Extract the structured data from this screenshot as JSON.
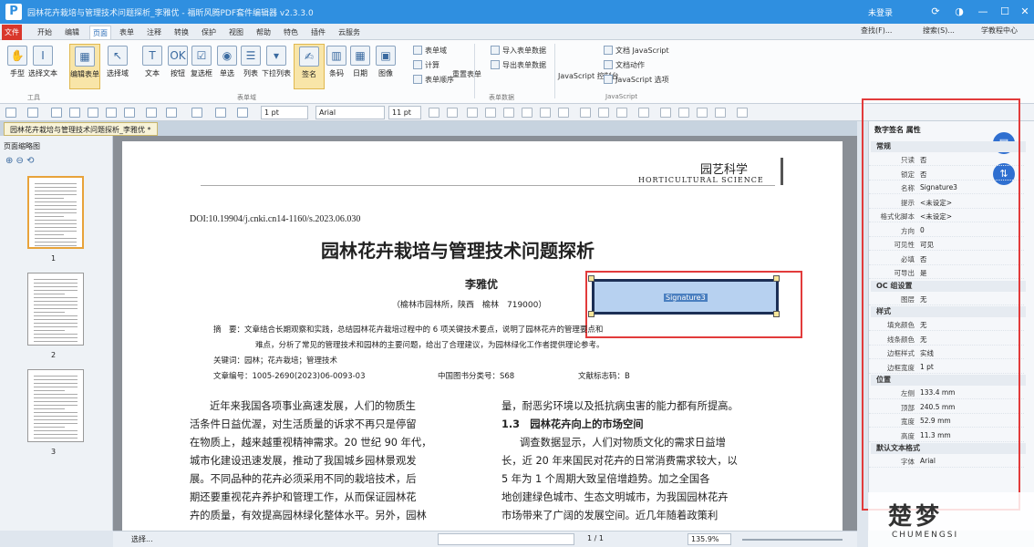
{
  "titlebar": {
    "app_logo": "P",
    "title": "园林花卉栽培与管理技术问题探析_李雅优 - 福昕风腾PDF套件编辑器 v2.3.3.0",
    "user": "未登录"
  },
  "menu": {
    "file": "文件",
    "tabs": [
      "开始",
      "编辑",
      "页面",
      "表单",
      "注释",
      "转换",
      "保护",
      "视图",
      "帮助",
      "特色",
      "插件",
      "云服务"
    ],
    "active_index": 2,
    "right": [
      "查找(F)...",
      "搜索(S)...",
      "学教程中心"
    ]
  },
  "ribbon": {
    "big_buttons": [
      {
        "label": "手型"
      },
      {
        "label": "选择文本"
      },
      {
        "label": "编辑表单"
      },
      {
        "label": "选择域"
      },
      {
        "label": "文本"
      },
      {
        "label": "按钮"
      },
      {
        "label": "复选框"
      },
      {
        "label": "单选"
      },
      {
        "label": "列表"
      },
      {
        "label": "下拉列表"
      },
      {
        "label": "签名"
      },
      {
        "label": "条码"
      },
      {
        "label": "日期"
      },
      {
        "label": "图像"
      }
    ],
    "small_left": [
      "表单域",
      "计算",
      "表单顺序"
    ],
    "data_group": [
      "导入表单数据",
      "导出表单数据",
      "重置表单"
    ],
    "js_group": [
      "文档 JavaScript",
      "文档动作",
      "JavaScript 控制台",
      "JavaScript 选项"
    ],
    "group_labels": [
      "工具",
      "表单域",
      "表单数据",
      "JavaScript"
    ]
  },
  "toolbar": {
    "line_width": "1 pt",
    "font": "Arial",
    "font_size": "11 pt"
  },
  "doc_tab": "园林花卉栽培与管理技术问题探析_李雅优 *",
  "left_panel": {
    "title": "页面缩略图",
    "pages": [
      "1",
      "2",
      "3"
    ]
  },
  "page": {
    "journal_cn": "园艺科学",
    "journal_en": "HORTICULTURAL SCIENCE",
    "doi": "DOI:10.19904/j.cnki.cn14-1160/s.2023.06.030",
    "title": "园林花卉栽培与管理技术问题探析",
    "author": "李雅优",
    "affiliation": "（榆林市园林所，陕西　榆林　719000）",
    "signature_field": "Signature3",
    "abstract1": "摘　要：文章结合长期观察和实践，总结园林花卉栽培过程中的 6 项关键技术要点，说明了园林花卉的管理要点和",
    "abstract2": "难点，分析了常见的管理技术和园林的主要问题，给出了合理建议，为园林绿化工作者提供理论参考。",
    "keywords": "关键词：园林；花卉栽培；管理技术",
    "meta_a": "文章编号：1005-2690(2023)06-0093-03",
    "meta_b": "中国图书分类号：S68",
    "meta_c": "文献标志码：B",
    "left_col": [
      "近年来我国各项事业高速发展，人们的物质生",
      "活条件日益优渥，对生活质量的诉求不再只是停留",
      "在物质上，越来越重视精神需求。20 世纪 90 年代，",
      "城市化建设迅速发展，推动了我国城乡园林景观发",
      "展。不同品种的花卉必须采用不同的栽培技术，后",
      "期还要重视花卉养护和管理工作，从而保证园林花",
      "卉的质量，有效提高园林绿化整体水平。另外，园林"
    ],
    "right_col": [
      "量，耐恶劣环境以及抵抗病虫害的能力都有所提高。",
      "1.3　园林花卉向上的市场空间",
      "调查数据显示，人们对物质文化的需求日益增",
      "长，近 20 年来国民对花卉的日常消费需求较大，以",
      "5 年为 1 个周期大致呈倍增趋势。加之全国各",
      "地创建绿色城市、生态文明城市，为我国园林花卉",
      "市场带来了广阔的发展空间。近几年随着政策利"
    ]
  },
  "right_panel": {
    "title": "数字签名 属性",
    "sections": [
      {
        "name": "常规",
        "rows": [
          [
            "只读",
            "否"
          ],
          [
            "锁定",
            "否"
          ],
          [
            "名称",
            "Signature3"
          ],
          [
            "提示",
            "<未设定>"
          ],
          [
            "格式化脚本",
            "<未设定>"
          ],
          [
            "方向",
            "0"
          ],
          [
            "可见性",
            "可见"
          ],
          [
            "必填",
            "否"
          ],
          [
            "可导出",
            "是"
          ]
        ]
      },
      {
        "name": "OC 组设置",
        "rows": [
          [
            "图层",
            "无"
          ]
        ]
      },
      {
        "name": "样式",
        "rows": [
          [
            "填充颜色",
            "无"
          ],
          [
            "线条颜色",
            "无"
          ],
          [
            "边框样式",
            "实线"
          ],
          [
            "边框宽度",
            "1 pt"
          ]
        ]
      },
      {
        "name": "位置",
        "rows": [
          [
            "左侧",
            "133.4 mm"
          ],
          [
            "顶部",
            "240.5 mm"
          ],
          [
            "宽度",
            "52.9 mm"
          ],
          [
            "高度",
            "11.3 mm"
          ]
        ]
      },
      {
        "name": "默认文本格式",
        "rows": [
          [
            "字体",
            "Arial"
          ]
        ]
      }
    ]
  },
  "status": {
    "page": "1 / 1",
    "zoom": "135.9%",
    "select_tool": "选择..."
  },
  "watermark": {
    "brand": "楚梦",
    "sub": "CHUMENGSI"
  }
}
